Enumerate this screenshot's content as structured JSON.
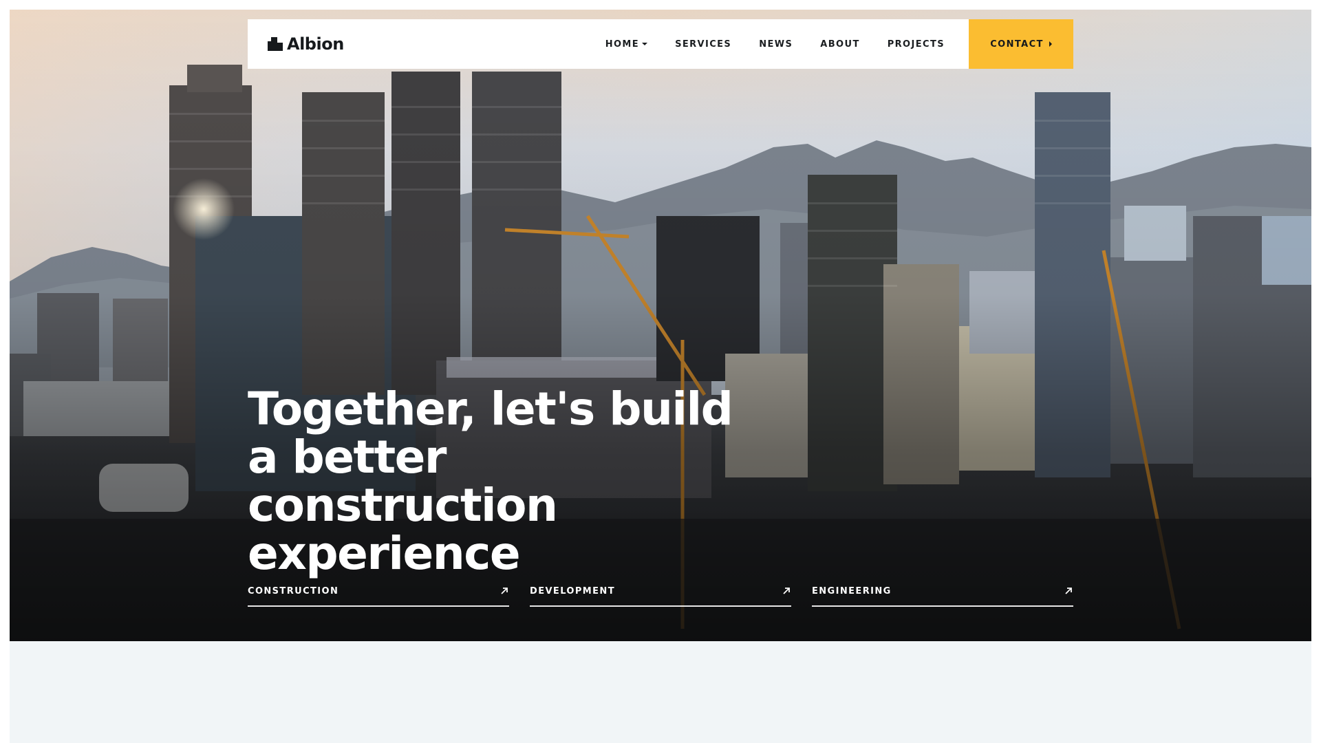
{
  "site": {
    "brand": "Albion",
    "brand_icon": "building-icon"
  },
  "nav": {
    "items": [
      {
        "label": "HOME",
        "has_dropdown": true
      },
      {
        "label": "SERVICES"
      },
      {
        "label": "NEWS"
      },
      {
        "label": "ABOUT"
      },
      {
        "label": "PROJECTS"
      }
    ],
    "contact_label": "CONTACT",
    "contact_icon": "chevron-right-icon",
    "dropdown_icon": "chevron-down-icon"
  },
  "hero": {
    "headline": "Together, let's build a better construction experience",
    "background": "city-skyline-construction-photo",
    "services": [
      {
        "label": "CONSTRUCTION",
        "icon": "arrow-up-right-icon"
      },
      {
        "label": "DEVELOPMENT",
        "icon": "arrow-up-right-icon"
      },
      {
        "label": "ENGINEERING",
        "icon": "arrow-up-right-icon"
      }
    ]
  },
  "colors": {
    "accent": "#fbbd31",
    "text_dark": "#16191c",
    "page_bg": "#f1f5f7",
    "white": "#ffffff"
  }
}
